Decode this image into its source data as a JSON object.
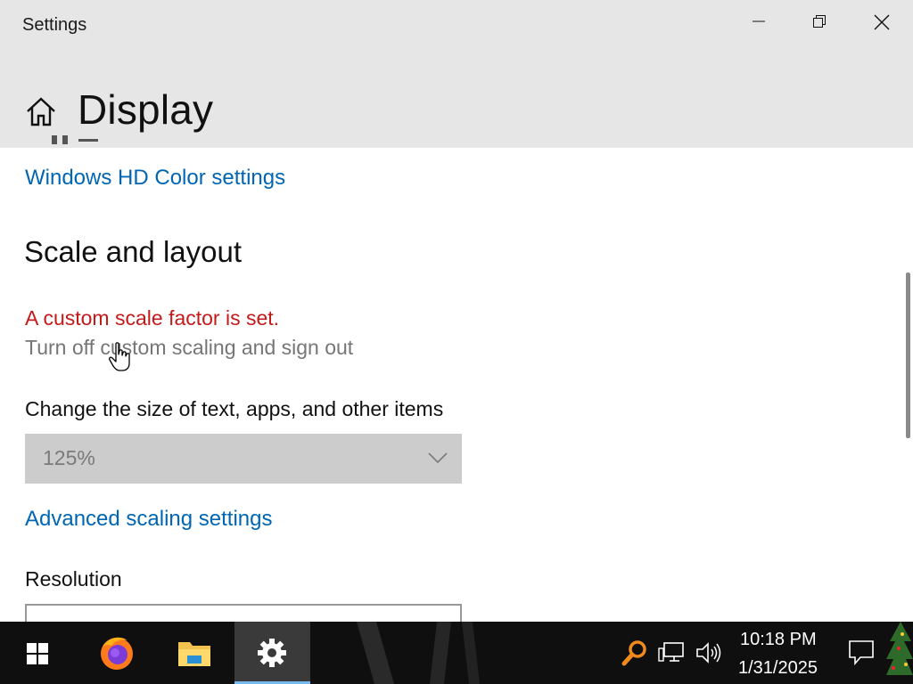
{
  "window": {
    "app_title": "Settings",
    "page_title": "Display"
  },
  "content": {
    "clipped_text": "...pp...",
    "hd_color_link": "Windows HD Color settings",
    "section_title": "Scale and layout",
    "warning_text": "A custom scale factor is set.",
    "turn_off_link": "Turn off custom scaling and sign out",
    "size_label": "Change the size of text, apps, and other items",
    "scale_dropdown": {
      "value": "125%",
      "enabled": false
    },
    "advanced_link": "Advanced scaling settings",
    "resolution_label": "Resolution"
  },
  "taskbar": {
    "apps": [
      {
        "name": "Start",
        "icon": "windows-logo-icon"
      },
      {
        "name": "Firefox",
        "icon": "firefox-icon"
      },
      {
        "name": "File Explorer",
        "icon": "folder-icon"
      },
      {
        "name": "Settings",
        "icon": "gear-icon",
        "active": true
      }
    ],
    "tray": {
      "icons": [
        "search-magnifier-icon",
        "network-icon",
        "volume-icon"
      ],
      "time": "10:18 PM",
      "date": "1/31/2025"
    }
  },
  "colors": {
    "header_bg": "#e6e6e6",
    "link": "#0066b4",
    "warning": "#c41a1a",
    "taskbar": "#0f0f0f",
    "active_app_underline": "#76b9ed"
  }
}
